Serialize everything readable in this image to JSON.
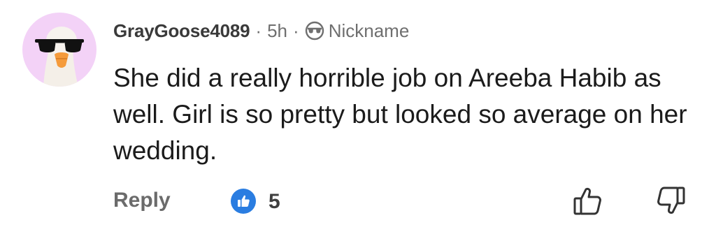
{
  "comment": {
    "author": {
      "username": "GrayGoose4089",
      "avatar_icon": "goose-with-sunglasses",
      "avatar_bg": "#f3d2f7"
    },
    "separator": "·",
    "time": "5h",
    "badge_icon": "sunglasses-face-icon",
    "badge_label": "Nickname",
    "text": "She did a really horrible job on Areeba Habib as well. Girl is so pretty but looked so average on her wedding.",
    "actions": {
      "reply_label": "Reply",
      "like_count": "5",
      "like_color": "#2a7de1",
      "upvote_icon": "thumbs-up-icon",
      "downvote_icon": "thumbs-down-icon"
    }
  }
}
